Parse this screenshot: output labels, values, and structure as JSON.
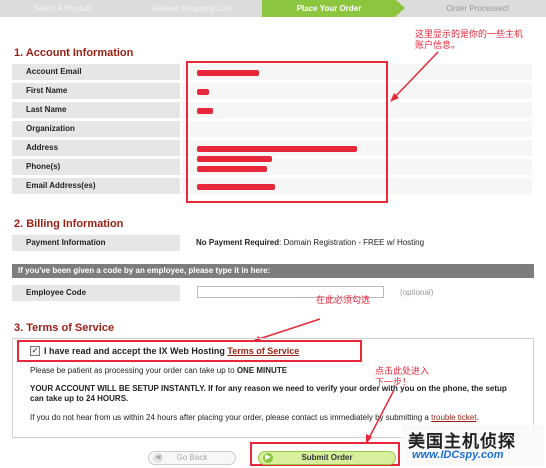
{
  "steps": [
    "Select A Product",
    "Review Shopping Cart",
    "Place Your Order",
    "Order Processed!"
  ],
  "account": {
    "title": "1. Account Information",
    "fields": [
      "Account Email",
      "First Name",
      "Last Name",
      "Organization",
      "Address",
      "Phone(s)",
      "Email Address(es)"
    ],
    "annotation": "这里显示的是你的一些主机账户信息。"
  },
  "billing": {
    "title": "2. Billing Information",
    "label": "Payment Information",
    "value_bold": "No Payment Required",
    "value_rest": ": Domain Registration - FREE w/ Hosting"
  },
  "employee": {
    "header": "If you've been given a code by an employee, please type it in here:",
    "label": "Employee Code",
    "input_value": "",
    "hint": "(optional)"
  },
  "tos": {
    "title": "3. Terms of Service",
    "annotation": "在此必须勾选",
    "checkbox_checked": true,
    "accept_text": "I have read and accept the IX Web Hosting",
    "accept_link": "Terms of Service",
    "p1_a": "Please be patient as processing your order can take up to",
    "p1_b": "ONE MINUTE",
    "p2": "YOUR ACCOUNT WILL BE SETUP INSTANTLY. If for any reason we need to verify your order with you on the phone, the setup can take up to 24 HOURS.",
    "p3_a": "If you do not hear from us within 24 hours after placing your order, please contact us immediately by submitting a",
    "p3_link": "trouble ticket",
    "p3_b": "."
  },
  "buttons": {
    "back": "Go Back",
    "submit": "Submit Order",
    "annotation": "点击此处进入下一步！"
  },
  "watermark": {
    "line1": "美国主机侦探",
    "line2": "www.IDCspy.com"
  }
}
